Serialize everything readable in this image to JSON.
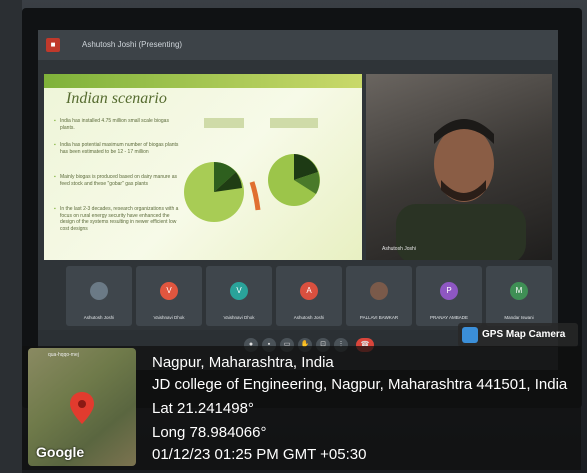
{
  "meeting": {
    "presenter_label": "Ashutosh Joshi (Presenting)",
    "app_icon": "meet-logo-icon"
  },
  "slide": {
    "title": "Indian scenario",
    "bullets": [
      "India has installed 4.75 million small scale biogas plants.",
      "India has potential maximum number of biogas plants has been estimated to be 12 - 17 million",
      "Mainly biogas is produced based on dairy manure as feed stock and these \"gobar\" gas plants",
      "In the last 2-3 decades, research organizations with a focus on rural energy security have enhanced the design of the systems resulting in newer efficient low cost designs"
    ]
  },
  "video": {
    "participant_name": "Ashutosh Joshi"
  },
  "participants": [
    {
      "name": "Ashutosh Joshi",
      "initial": "",
      "color": "#6b7a86"
    },
    {
      "name": "Vaishnavi Dhok",
      "initial": "V",
      "color": "#e0563f"
    },
    {
      "name": "Vaishnavi Dhok",
      "initial": "V",
      "color": "#2aa39a"
    },
    {
      "name": "Ashutosh Joshi",
      "initial": "A",
      "color": "#d9503f"
    },
    {
      "name": "PALLAVI BAWKAR",
      "initial": "",
      "color": "#7a5a4a"
    },
    {
      "name": "PRANAY AMBADE",
      "initial": "P",
      "color": "#8e57c2"
    },
    {
      "name": "Mandar Iswani",
      "initial": "M",
      "color": "#3f8f55"
    }
  ],
  "controls": {
    "meeting_code": "qua-hqqo-mej"
  },
  "gps": {
    "badge": "GPS Map Camera",
    "map_label": "qua-hqqo-mej",
    "google": "Google",
    "city": "Nagpur, Maharashtra, India",
    "address": "JD college of Engineering, Nagpur, Maharashtra 441501, India",
    "lat": "Lat 21.241498°",
    "long": "Long 78.984066°",
    "datetime": "01/12/23 01:25 PM GMT +05:30"
  }
}
